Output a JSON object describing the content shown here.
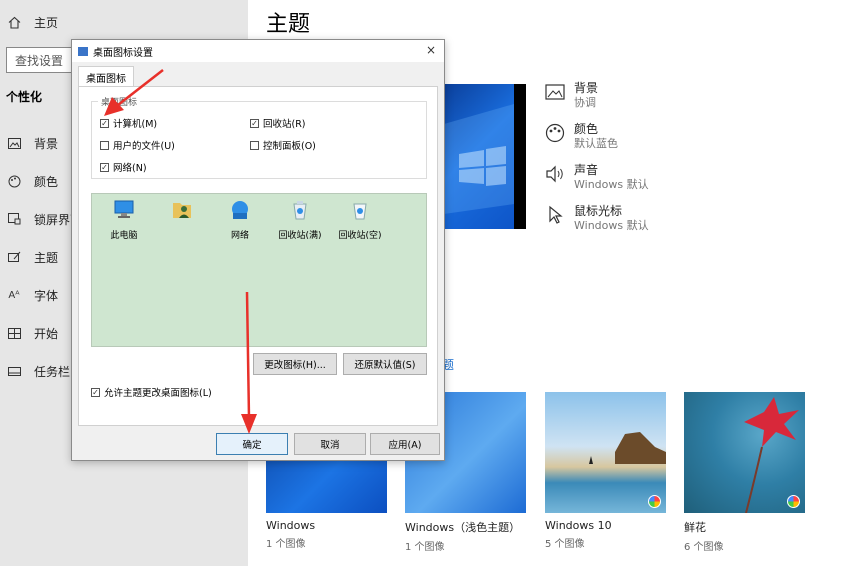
{
  "nav": {
    "home_label": "主页",
    "search_placeholder": "查找设置",
    "section_title": "个性化",
    "items": [
      {
        "label": "背景",
        "icon": "picture-icon"
      },
      {
        "label": "颜色",
        "icon": "palette-icon"
      },
      {
        "label": "锁屏界面",
        "icon": "lock-screen-icon"
      },
      {
        "label": "主题",
        "icon": "theme-icon"
      },
      {
        "label": "字体",
        "icon": "font-icon"
      },
      {
        "label": "开始",
        "icon": "start-icon"
      },
      {
        "label": "任务栏",
        "icon": "taskbar-icon"
      }
    ]
  },
  "content": {
    "title": "主题",
    "settings": [
      {
        "title": "背景",
        "subtitle": "协调"
      },
      {
        "title": "颜色",
        "subtitle": "默认蓝色"
      },
      {
        "title": "声音",
        "subtitle": "Windows 默认"
      },
      {
        "title": "鼠标光标",
        "subtitle": "Windows 默认"
      }
    ],
    "link_fragment": "题",
    "themes": [
      {
        "name": "Windows",
        "count": "1 个图像"
      },
      {
        "name": "Windows（浅色主题）",
        "count": "1 个图像"
      },
      {
        "name": "Windows 10",
        "count": "5 个图像"
      },
      {
        "name": "鲜花",
        "count": "6 个图像"
      }
    ]
  },
  "dialog": {
    "title": "桌面图标设置",
    "tab": "桌面图标",
    "group_label": "桌面图标",
    "checkboxes": [
      {
        "label": "计算机(M)",
        "checked": true
      },
      {
        "label": "回收站(R)",
        "checked": true
      },
      {
        "label": "用户的文件(U)",
        "checked": false
      },
      {
        "label": "控制面板(O)",
        "checked": false
      },
      {
        "label": "网络(N)",
        "checked": true
      }
    ],
    "icons": [
      "此电脑",
      "",
      "网络",
      "回收站(满)",
      "回收站(空)"
    ],
    "change_icon": "更改图标(H)...",
    "restore_default": "还原默认值(S)",
    "allow_theme": "允许主题更改桌面图标(L)",
    "allow_theme_checked": true,
    "ok": "确定",
    "cancel": "取消",
    "apply": "应用(A)"
  },
  "colors": {
    "annotation_arrow": "#e8302a",
    "icons_background": "#cfe6d0",
    "accent": "#0078d7"
  }
}
